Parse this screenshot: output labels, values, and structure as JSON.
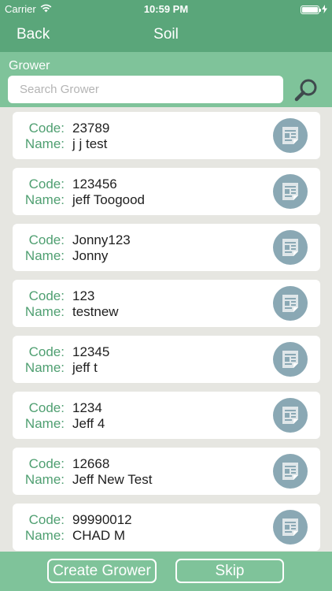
{
  "status_bar": {
    "carrier": "Carrier",
    "time": "10:59 PM",
    "battery_level": 1.0
  },
  "nav": {
    "back_label": "Back",
    "title": "Soil"
  },
  "search": {
    "label": "Grower",
    "placeholder": "Search Grower",
    "value": "",
    "icon": "search-icon"
  },
  "list": {
    "code_label": "Code:",
    "name_label": "Name:",
    "action_icon": "document-icon",
    "items": [
      {
        "code": "23789",
        "name": "j j test"
      },
      {
        "code": "123456",
        "name": "jeff Toogood"
      },
      {
        "code": "Jonny123",
        "name": "Jonny"
      },
      {
        "code": "123",
        "name": "testnew"
      },
      {
        "code": "12345",
        "name": "jeff t"
      },
      {
        "code": "1234",
        "name": "Jeff 4"
      },
      {
        "code": "12668",
        "name": "Jeff New Test"
      },
      {
        "code": "99990012",
        "name": "CHAD M"
      }
    ]
  },
  "bottom": {
    "create_label": "Create Grower",
    "skip_label": "Skip"
  },
  "colors": {
    "header": "#5aa67a",
    "subheader": "#7fc39a",
    "label_green": "#4f9f71",
    "doc_button": "#8aa8b4",
    "background": "#e6e6e1"
  }
}
